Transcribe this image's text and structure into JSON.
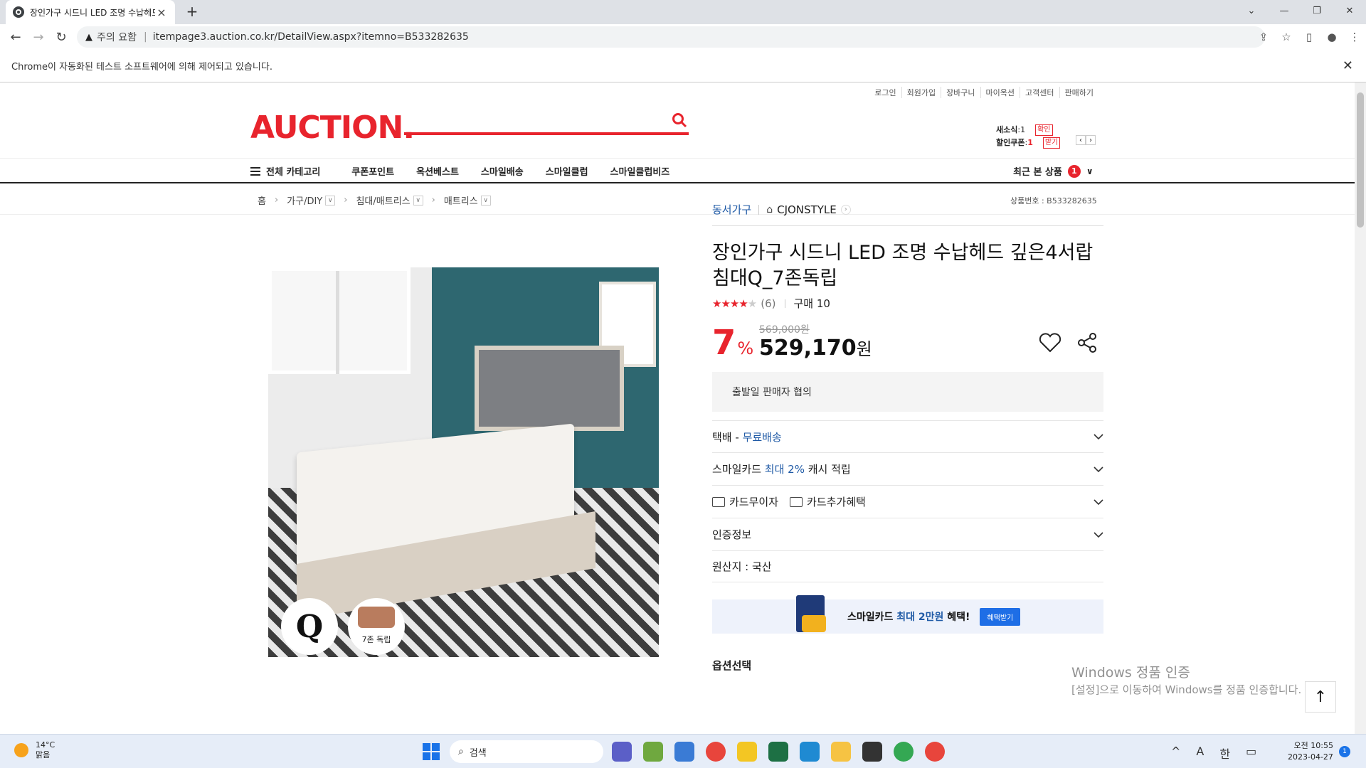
{
  "browser": {
    "tab_title": "장인가구 시드니 LED 조명 수납헤드",
    "security_label": "주의 요함",
    "url": "itempage3.auction.co.kr/DetailView.aspx?itemno=B533282635",
    "infobar_text": "Chrome이 자동화된 테스트 소프트웨어에 의해 제어되고 있습니다."
  },
  "header": {
    "util_links": [
      "로그인",
      "회원가입",
      "장바구니",
      "마이옥션",
      "고객센터",
      "판매하기"
    ],
    "logo": "AUCTION.",
    "msg_label": "새소식",
    "msg_count": ":1",
    "msg_btn": "확인",
    "coupon_label": "할인쿠폰",
    "coupon_count": "1",
    "coupon_btn": "받기"
  },
  "gnb": {
    "all_category": "전체 카테고리",
    "items": [
      "쿠폰포인트",
      "옥션베스트",
      "스마일배송",
      "스마일클럽",
      "스마일클럽비즈"
    ],
    "recent_label": "최근 본 상품",
    "recent_count": "1"
  },
  "breadcrumb": {
    "home": "홈",
    "levels": [
      "가구/DIY",
      "침대/매트리스",
      "매트리스"
    ],
    "product_no": "상품번호 : B533282635"
  },
  "product": {
    "image_badge": "7존 독립",
    "seller": "동서가구",
    "store": "CJONSTYLE",
    "title": "장인가구 시드니 LED 조명 수납헤드 깊은4서랍 침대Q_7존독립",
    "rating": 4,
    "review_count": "(6)",
    "purchase": "구매 10",
    "discount": "7",
    "discount_unit": "%",
    "original_price": "569,000원",
    "price": "529,170",
    "price_unit": "원",
    "ship_notice": "출발일 판매자 협의",
    "delivery_label": "택배 - ",
    "delivery_value": "무료배송",
    "smilecard_pre": "스마일카드 ",
    "smilecard_highlight": "최대 2%",
    "smilecard_post": " 캐시 적립",
    "card_installment": "카드무이자",
    "card_benefit": "카드추가혜택",
    "cert": "인증정보",
    "origin": "원산지 : 국산",
    "banner_pre": "스마일카드 ",
    "banner_highlight": "최대 2만원",
    "banner_post": " 혜택!",
    "banner_btn": "혜택받기",
    "option_label": "옵션선택"
  },
  "watermark": {
    "title": "Windows 정품 인증",
    "sub": "[설정]으로 이동하여 Windows를 정품 인증합니다."
  },
  "taskbar": {
    "temp": "14°C",
    "weather": "맑음",
    "search_placeholder": "검색",
    "time": "오전 10:55",
    "date": "2023-04-27",
    "notif": "1",
    "tray": [
      "^",
      "A",
      "한"
    ]
  }
}
